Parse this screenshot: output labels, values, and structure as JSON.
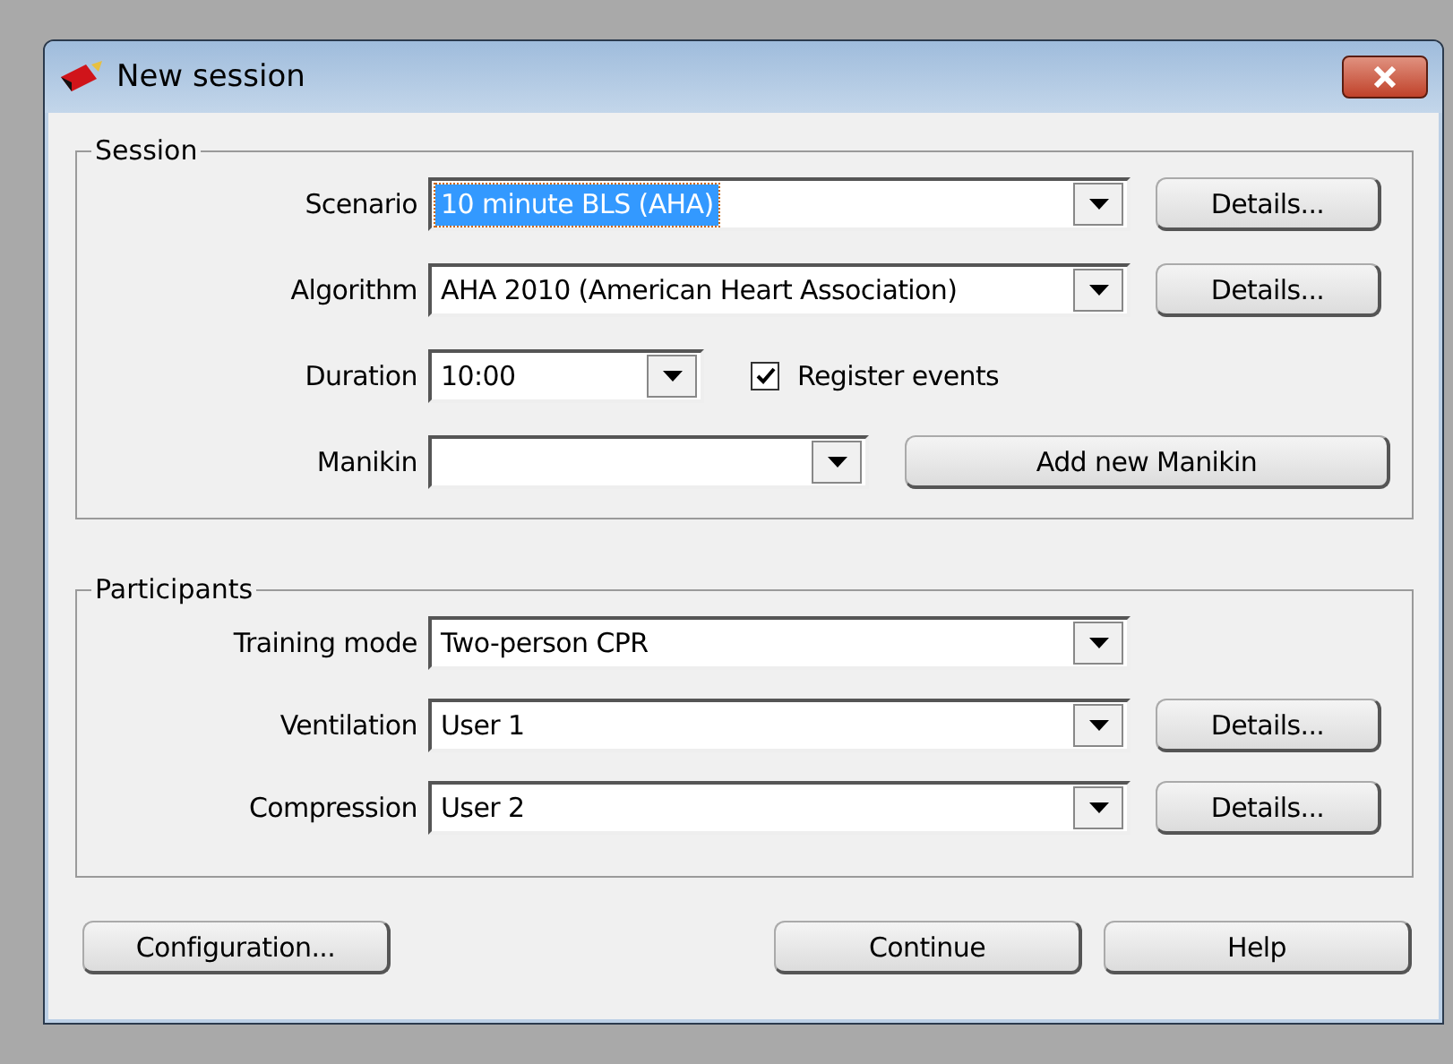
{
  "window": {
    "title": "New session"
  },
  "session": {
    "title": "Session",
    "fields": [
      {
        "label": "Scenario",
        "value": "10 minute BLS (AHA)",
        "kind": "wide",
        "highlighted": true,
        "button": "Details..."
      },
      {
        "label": "Algorithm",
        "value": "AHA 2010 (American Heart Association)",
        "kind": "wide",
        "highlighted": false,
        "button": "Details..."
      },
      {
        "label": "Duration",
        "value": "10:00",
        "kind": "short",
        "highlighted": false,
        "checkbox": {
          "label": "Register events",
          "checked": true
        }
      },
      {
        "label": "Manikin",
        "kind": "medium",
        "button": "Add new Manikin"
      }
    ]
  },
  "participants": {
    "title": "Participants",
    "fields": [
      {
        "label": "Training mode",
        "value": "Two-person CPR",
        "kind": "wide",
        "highlighted": false
      },
      {
        "label": "Ventilation",
        "value": "User 1",
        "kind": "wide",
        "highlighted": false,
        "button": "Details..."
      },
      {
        "label": "Compression",
        "value": "User 2",
        "kind": "wide",
        "highlighted": false,
        "button": "Details..."
      }
    ]
  },
  "buttons": {
    "left": "Configuration...",
    "continue": "Continue",
    "help": "Help"
  }
}
